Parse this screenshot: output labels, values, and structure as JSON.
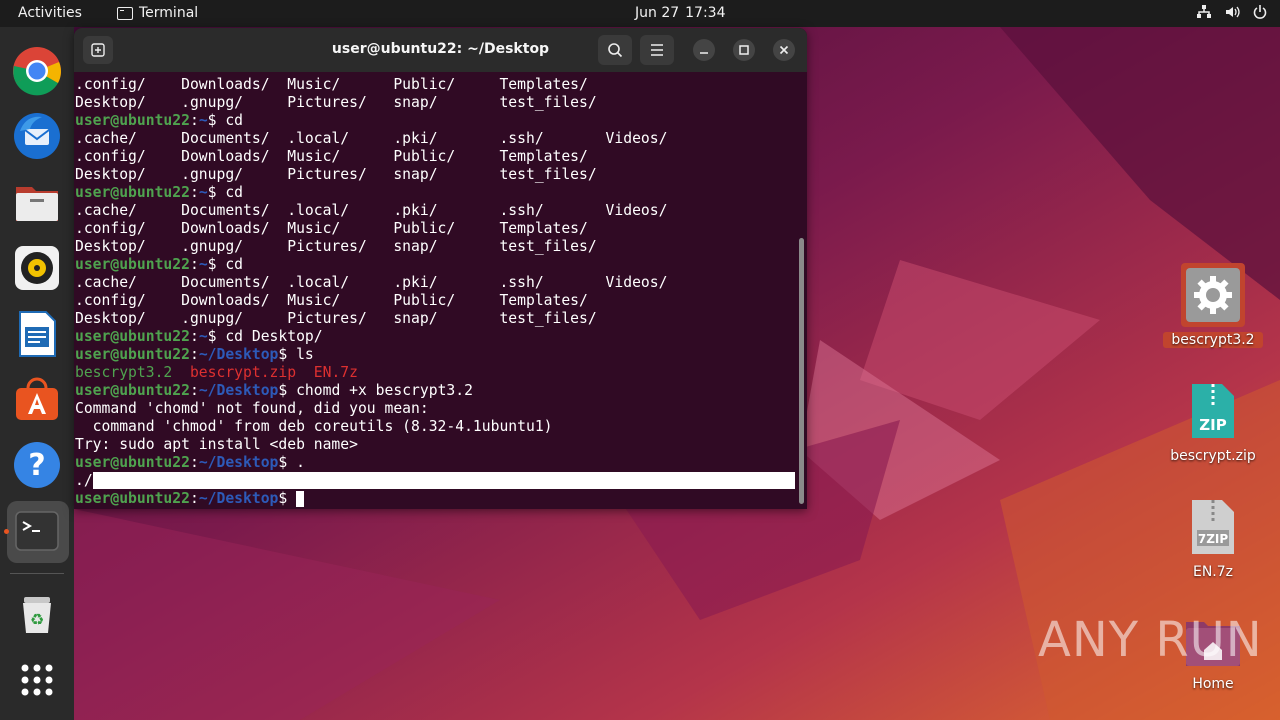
{
  "topbar": {
    "activities": "Activities",
    "app_name": "Terminal",
    "date": "Jun 27",
    "time": "17:34"
  },
  "dock": {
    "items": [
      "chrome-icon",
      "thunderbird-icon",
      "files-icon",
      "rhythmbox-icon",
      "writer-icon",
      "app-center-icon",
      "help-icon",
      "terminal-icon",
      "trash-icon",
      "show-apps-icon"
    ]
  },
  "terminal": {
    "title": "user@ubuntu22: ~/Desktop",
    "prompt_user": "user@ubuntu22",
    "home_path": "~",
    "desktop_path": "~/Desktop",
    "lines": {
      "l1": ".config/    Downloads/  Music/      Public/     Templates/",
      "l2": "Desktop/    .gnupg/     Pictures/   snap/       test_files/",
      "cmd_cd": "$ cd",
      "l4": ".cache/     Documents/  .local/     .pki/       .ssh/       Videos/",
      "l5": ".config/    Downloads/  Music/      Public/     Templates/",
      "l6": "Desktop/    .gnupg/     Pictures/   snap/       test_files/",
      "cmd_cd_desktop": "$ cd Desktop/",
      "cmd_ls": "$ ls",
      "ls_exec": "bescrypt3.2",
      "ls_zip": "bescrypt.zip",
      "ls_7z": "EN.7z",
      "cmd_chomd": "$ chomd +x bescrypt3.2",
      "err1": "Command 'chomd' not found, did you mean:",
      "err2": "  command 'chmod' from deb coreutils (8.32-4.1ubuntu1)",
      "err3": "Try: sudo apt install <deb name>",
      "cmd_dot": "$ .",
      "dot_out": "./",
      "prompt_end": "$ "
    }
  },
  "desktop": {
    "icons": [
      {
        "label": "bescrypt3.2"
      },
      {
        "label": "bescrypt.zip"
      },
      {
        "label": "EN.7z"
      },
      {
        "label": "Home"
      }
    ]
  },
  "watermark": "ANY RUN",
  "colors": {
    "terminal_bg": "#300a24",
    "prompt_user": "#4fa34f",
    "prompt_path": "#2d5ab8",
    "zip_file": "#dd3030",
    "accent": "#e95420"
  }
}
